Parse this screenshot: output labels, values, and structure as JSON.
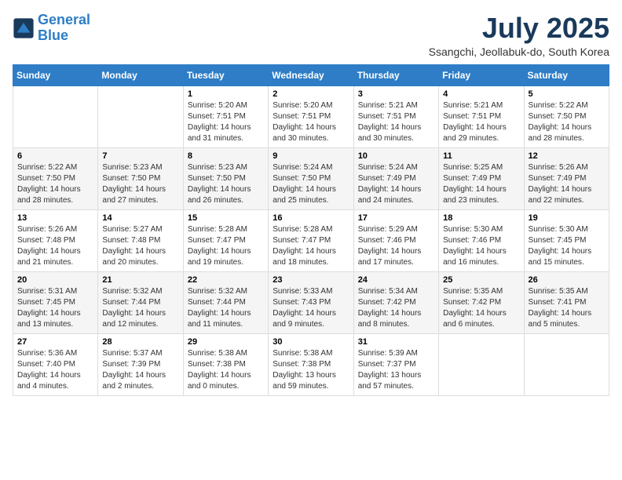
{
  "logo": {
    "line1": "General",
    "line2": "Blue"
  },
  "title": "July 2025",
  "location": "Ssangchi, Jeollabuk-do, South Korea",
  "weekdays": [
    "Sunday",
    "Monday",
    "Tuesday",
    "Wednesday",
    "Thursday",
    "Friday",
    "Saturday"
  ],
  "weeks": [
    [
      {
        "day": "",
        "sunrise": "",
        "sunset": "",
        "daylight": ""
      },
      {
        "day": "",
        "sunrise": "",
        "sunset": "",
        "daylight": ""
      },
      {
        "day": "1",
        "sunrise": "Sunrise: 5:20 AM",
        "sunset": "Sunset: 7:51 PM",
        "daylight": "Daylight: 14 hours and 31 minutes."
      },
      {
        "day": "2",
        "sunrise": "Sunrise: 5:20 AM",
        "sunset": "Sunset: 7:51 PM",
        "daylight": "Daylight: 14 hours and 30 minutes."
      },
      {
        "day": "3",
        "sunrise": "Sunrise: 5:21 AM",
        "sunset": "Sunset: 7:51 PM",
        "daylight": "Daylight: 14 hours and 30 minutes."
      },
      {
        "day": "4",
        "sunrise": "Sunrise: 5:21 AM",
        "sunset": "Sunset: 7:51 PM",
        "daylight": "Daylight: 14 hours and 29 minutes."
      },
      {
        "day": "5",
        "sunrise": "Sunrise: 5:22 AM",
        "sunset": "Sunset: 7:50 PM",
        "daylight": "Daylight: 14 hours and 28 minutes."
      }
    ],
    [
      {
        "day": "6",
        "sunrise": "Sunrise: 5:22 AM",
        "sunset": "Sunset: 7:50 PM",
        "daylight": "Daylight: 14 hours and 28 minutes."
      },
      {
        "day": "7",
        "sunrise": "Sunrise: 5:23 AM",
        "sunset": "Sunset: 7:50 PM",
        "daylight": "Daylight: 14 hours and 27 minutes."
      },
      {
        "day": "8",
        "sunrise": "Sunrise: 5:23 AM",
        "sunset": "Sunset: 7:50 PM",
        "daylight": "Daylight: 14 hours and 26 minutes."
      },
      {
        "day": "9",
        "sunrise": "Sunrise: 5:24 AM",
        "sunset": "Sunset: 7:50 PM",
        "daylight": "Daylight: 14 hours and 25 minutes."
      },
      {
        "day": "10",
        "sunrise": "Sunrise: 5:24 AM",
        "sunset": "Sunset: 7:49 PM",
        "daylight": "Daylight: 14 hours and 24 minutes."
      },
      {
        "day": "11",
        "sunrise": "Sunrise: 5:25 AM",
        "sunset": "Sunset: 7:49 PM",
        "daylight": "Daylight: 14 hours and 23 minutes."
      },
      {
        "day": "12",
        "sunrise": "Sunrise: 5:26 AM",
        "sunset": "Sunset: 7:49 PM",
        "daylight": "Daylight: 14 hours and 22 minutes."
      }
    ],
    [
      {
        "day": "13",
        "sunrise": "Sunrise: 5:26 AM",
        "sunset": "Sunset: 7:48 PM",
        "daylight": "Daylight: 14 hours and 21 minutes."
      },
      {
        "day": "14",
        "sunrise": "Sunrise: 5:27 AM",
        "sunset": "Sunset: 7:48 PM",
        "daylight": "Daylight: 14 hours and 20 minutes."
      },
      {
        "day": "15",
        "sunrise": "Sunrise: 5:28 AM",
        "sunset": "Sunset: 7:47 PM",
        "daylight": "Daylight: 14 hours and 19 minutes."
      },
      {
        "day": "16",
        "sunrise": "Sunrise: 5:28 AM",
        "sunset": "Sunset: 7:47 PM",
        "daylight": "Daylight: 14 hours and 18 minutes."
      },
      {
        "day": "17",
        "sunrise": "Sunrise: 5:29 AM",
        "sunset": "Sunset: 7:46 PM",
        "daylight": "Daylight: 14 hours and 17 minutes."
      },
      {
        "day": "18",
        "sunrise": "Sunrise: 5:30 AM",
        "sunset": "Sunset: 7:46 PM",
        "daylight": "Daylight: 14 hours and 16 minutes."
      },
      {
        "day": "19",
        "sunrise": "Sunrise: 5:30 AM",
        "sunset": "Sunset: 7:45 PM",
        "daylight": "Daylight: 14 hours and 15 minutes."
      }
    ],
    [
      {
        "day": "20",
        "sunrise": "Sunrise: 5:31 AM",
        "sunset": "Sunset: 7:45 PM",
        "daylight": "Daylight: 14 hours and 13 minutes."
      },
      {
        "day": "21",
        "sunrise": "Sunrise: 5:32 AM",
        "sunset": "Sunset: 7:44 PM",
        "daylight": "Daylight: 14 hours and 12 minutes."
      },
      {
        "day": "22",
        "sunrise": "Sunrise: 5:32 AM",
        "sunset": "Sunset: 7:44 PM",
        "daylight": "Daylight: 14 hours and 11 minutes."
      },
      {
        "day": "23",
        "sunrise": "Sunrise: 5:33 AM",
        "sunset": "Sunset: 7:43 PM",
        "daylight": "Daylight: 14 hours and 9 minutes."
      },
      {
        "day": "24",
        "sunrise": "Sunrise: 5:34 AM",
        "sunset": "Sunset: 7:42 PM",
        "daylight": "Daylight: 14 hours and 8 minutes."
      },
      {
        "day": "25",
        "sunrise": "Sunrise: 5:35 AM",
        "sunset": "Sunset: 7:42 PM",
        "daylight": "Daylight: 14 hours and 6 minutes."
      },
      {
        "day": "26",
        "sunrise": "Sunrise: 5:35 AM",
        "sunset": "Sunset: 7:41 PM",
        "daylight": "Daylight: 14 hours and 5 minutes."
      }
    ],
    [
      {
        "day": "27",
        "sunrise": "Sunrise: 5:36 AM",
        "sunset": "Sunset: 7:40 PM",
        "daylight": "Daylight: 14 hours and 4 minutes."
      },
      {
        "day": "28",
        "sunrise": "Sunrise: 5:37 AM",
        "sunset": "Sunset: 7:39 PM",
        "daylight": "Daylight: 14 hours and 2 minutes."
      },
      {
        "day": "29",
        "sunrise": "Sunrise: 5:38 AM",
        "sunset": "Sunset: 7:38 PM",
        "daylight": "Daylight: 14 hours and 0 minutes."
      },
      {
        "day": "30",
        "sunrise": "Sunrise: 5:38 AM",
        "sunset": "Sunset: 7:38 PM",
        "daylight": "Daylight: 13 hours and 59 minutes."
      },
      {
        "day": "31",
        "sunrise": "Sunrise: 5:39 AM",
        "sunset": "Sunset: 7:37 PM",
        "daylight": "Daylight: 13 hours and 57 minutes."
      },
      {
        "day": "",
        "sunrise": "",
        "sunset": "",
        "daylight": ""
      },
      {
        "day": "",
        "sunrise": "",
        "sunset": "",
        "daylight": ""
      }
    ]
  ]
}
